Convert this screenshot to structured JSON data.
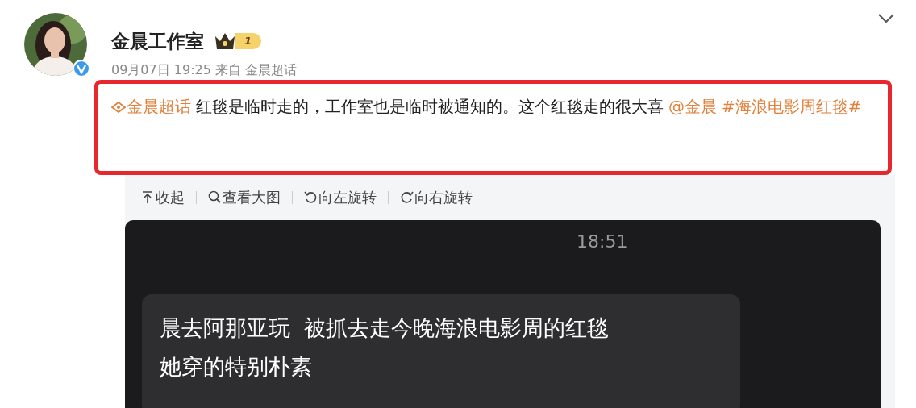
{
  "post": {
    "author": "金晨工作室",
    "level_badge": "1",
    "meta": "09月07日 19:25 来自 金晨超话",
    "text": [
      {
        "kind": "topic",
        "text": "金晨超话"
      },
      {
        "kind": "plain",
        "text": "红毯是临时走的，工作室也是临时被通知的。这个红毯走的很大喜"
      },
      {
        "kind": "mention",
        "text": "@金晨"
      },
      {
        "kind": "hashtag",
        "text": "#海浪电影周红毯#"
      }
    ]
  },
  "toolbar": [
    {
      "kind": "collapse",
      "label": "收起"
    },
    {
      "kind": "zoom",
      "label": "查看大图"
    },
    {
      "kind": "rotate_left",
      "label": "向左旋转"
    },
    {
      "kind": "rotate_right",
      "label": "向右旋转"
    }
  ],
  "image": {
    "time": "18:51",
    "message_lines": [
      "晨去阿那亚玩  被抓去走今晚海浪电影周的红毯",
      "她穿的特别朴素"
    ]
  }
}
